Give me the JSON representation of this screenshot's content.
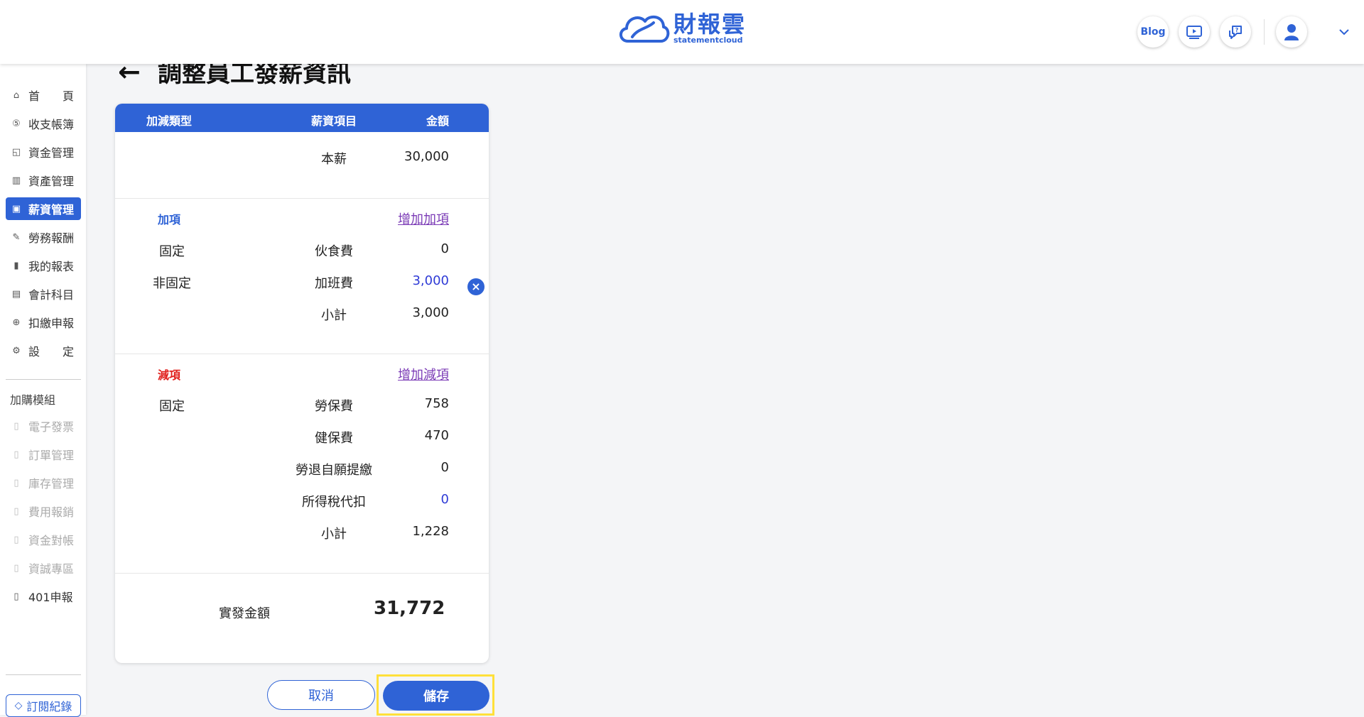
{
  "header": {
    "logo_main": "財報雲",
    "logo_sub": "statementcloud",
    "blog_label": "Blog"
  },
  "sidebar": {
    "items": [
      {
        "label": "首　　頁",
        "icon": "home-icon"
      },
      {
        "label": "收支帳簿",
        "icon": "coin-icon"
      },
      {
        "label": "資金管理",
        "icon": "fund-icon"
      },
      {
        "label": "資產管理",
        "icon": "asset-icon"
      },
      {
        "label": "薪資管理",
        "icon": "payroll-icon"
      },
      {
        "label": "勞務報酬",
        "icon": "labor-icon"
      },
      {
        "label": "我的報表",
        "icon": "report-icon"
      },
      {
        "label": "會計科目",
        "icon": "ledger-icon"
      },
      {
        "label": "扣繳申報",
        "icon": "withhold-icon"
      },
      {
        "label": "設　　定",
        "icon": "settings-icon"
      }
    ],
    "addon_group_label": "加購模組",
    "addons": [
      {
        "label": "電子發票",
        "enabled": false
      },
      {
        "label": "訂單管理",
        "enabled": false
      },
      {
        "label": "庫存管理",
        "enabled": false
      },
      {
        "label": "費用報銷",
        "enabled": false
      },
      {
        "label": "資金對帳",
        "enabled": false
      },
      {
        "label": "資誠專區",
        "enabled": false
      },
      {
        "label": "401申報",
        "enabled": true
      }
    ],
    "subscription_label": "訂閱紀錄"
  },
  "page": {
    "back_arrow": "←",
    "title": "調整員工發薪資訊"
  },
  "table": {
    "headers": [
      "加減類型",
      "薪資項目",
      "金額"
    ],
    "base": {
      "item": "本薪",
      "amount": "30,000"
    },
    "additions": {
      "label": "加項",
      "add_link": "增加加項",
      "rows": [
        {
          "type": "固定",
          "item": "伙食費",
          "amount": "0"
        },
        {
          "type": "非固定",
          "item": "加班費",
          "amount": "3,000"
        }
      ],
      "subtotal_label": "小計",
      "subtotal": "3,000"
    },
    "deductions": {
      "label": "減項",
      "add_link": "增加減項",
      "rows": [
        {
          "type": "固定",
          "item": "勞保費",
          "amount": "758"
        },
        {
          "type": "",
          "item": "健保費",
          "amount": "470"
        },
        {
          "type": "",
          "item": "勞退自願提繳",
          "amount": "0"
        },
        {
          "type": "",
          "item": "所得稅代扣",
          "amount": "0"
        }
      ],
      "subtotal_label": "小計",
      "subtotal": "1,228"
    },
    "net_label": "實發金額",
    "net_amount": "31,772"
  },
  "actions": {
    "cancel_label": "取消",
    "save_label": "儲存"
  },
  "colors": {
    "primary": "#2f63d6",
    "deduction_label": "#e0201d",
    "highlight_box": "#ffe03a"
  }
}
